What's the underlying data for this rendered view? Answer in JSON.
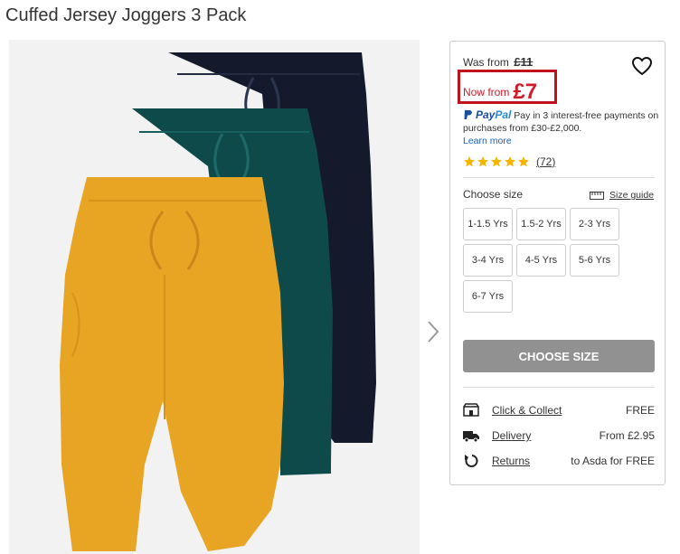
{
  "product": {
    "title": "Cuffed Jersey Joggers 3 Pack"
  },
  "pricing": {
    "was_label": "Was from",
    "was_price": "£11",
    "now_label": "Now from",
    "now_price": "£7"
  },
  "paypal": {
    "brand_pay": "Pay",
    "brand_pal": "Pal",
    "text": "Pay in 3 interest-free payments on purchases from £30-£2,000.",
    "link": "Learn more"
  },
  "rating": {
    "stars": 5,
    "max": 5,
    "count": "72"
  },
  "sizes": {
    "label": "Choose size",
    "guide": "Size guide",
    "options": [
      "1-1.5 Yrs",
      "1.5-2 Yrs",
      "2-3 Yrs",
      "3-4 Yrs",
      "4-5 Yrs",
      "5-6 Yrs",
      "6-7 Yrs"
    ]
  },
  "cta": {
    "label": "CHOOSE SIZE"
  },
  "delivery": [
    {
      "label": "Click & Collect",
      "value": "FREE",
      "icon": "store-icon"
    },
    {
      "label": "Delivery",
      "value": "From £2.95",
      "icon": "truck-icon"
    },
    {
      "label": "Returns",
      "value": "to Asda for FREE",
      "icon": "returns-icon"
    }
  ],
  "colors": {
    "price_red": "#d11a2a",
    "paypal_blue": "#1a4fa0",
    "star_yellow": "#f5b400",
    "cta_grey": "#919191"
  }
}
